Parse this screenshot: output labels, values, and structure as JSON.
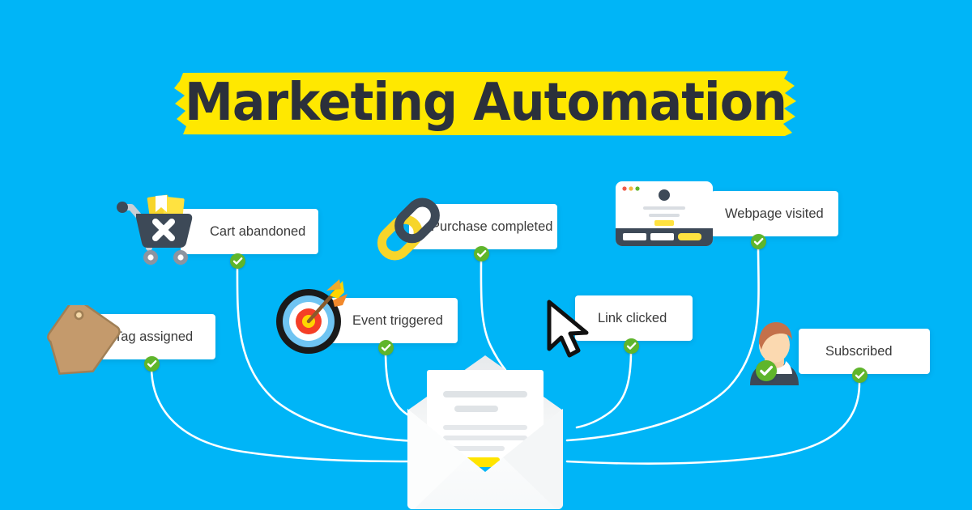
{
  "page": {
    "title": "Marketing Automation",
    "background_color": "#00B5F7",
    "banner_color": "#FFE800",
    "title_color": "#2B303B",
    "accent_yellow": "#FFE800",
    "check_green": "#5FB52B",
    "card_color": "#FFFFFF",
    "line_color": "#FFFFFF"
  },
  "center": {
    "name": "email-envelope",
    "button_color": "#FFE800"
  },
  "nodes": [
    {
      "id": "cart-abandoned",
      "label": "Cart abandoned",
      "icon": "shopping-cart-icon",
      "checked": true
    },
    {
      "id": "purchase-completed",
      "label": "Purchase completed",
      "icon": "chain-link-icon",
      "checked": true
    },
    {
      "id": "webpage-visited",
      "label": "Webpage visited",
      "icon": "browser-window-icon",
      "checked": true
    },
    {
      "id": "tag-assigned",
      "label": "Tag assigned",
      "icon": "price-tag-icon",
      "checked": true
    },
    {
      "id": "event-triggered",
      "label": "Event triggered",
      "icon": "target-dartboard-icon",
      "checked": true
    },
    {
      "id": "link-clicked",
      "label": "Link clicked",
      "icon": "mouse-cursor-icon",
      "checked": true
    },
    {
      "id": "subscribed",
      "label": "Subscribed",
      "icon": "person-avatar-icon",
      "checked": true
    }
  ]
}
